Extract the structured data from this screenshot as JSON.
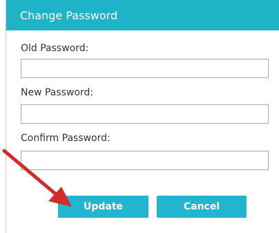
{
  "dialog": {
    "title": "Change Password"
  },
  "form": {
    "old_password_label": "Old Password:",
    "new_password_label": "New Password:",
    "confirm_password_label": "Confirm Password:"
  },
  "buttons": {
    "update_label": "Update",
    "cancel_label": "Cancel"
  },
  "annotation": {
    "arrow_color": "#d62a2a"
  },
  "colors": {
    "accent": "#1fb3c8"
  }
}
